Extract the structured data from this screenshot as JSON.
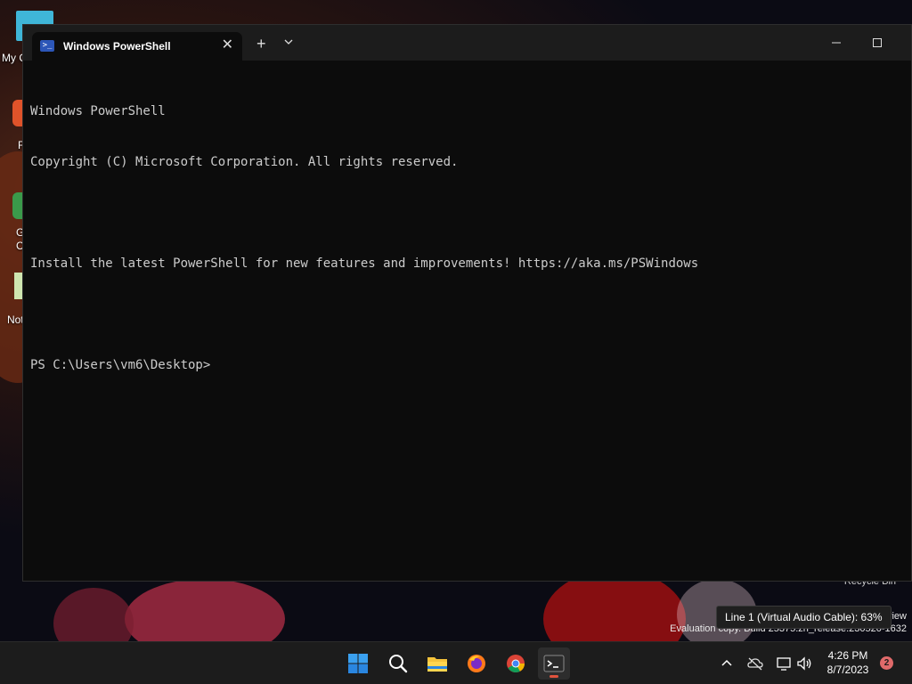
{
  "desktop": {
    "icons": [
      {
        "label": "My C",
        "top": 0
      },
      {
        "label": "F",
        "top": 0
      },
      {
        "label": "G",
        "top": 0
      },
      {
        "label": "C",
        "top": 0
      },
      {
        "label": "Not",
        "top": 0
      }
    ],
    "recycle_bin_label": "Recycle Bin",
    "watermark_preview": "view",
    "watermark_text": "Evaluation copy. Build 25375.zn_release.230520-1632",
    "tooltip_text": "Line 1 (Virtual Audio Cable): 63%"
  },
  "terminal": {
    "tab_title": "Windows PowerShell",
    "tab_icon": ">_",
    "new_tab_label": "+",
    "close_glyph": "✕",
    "console_lines": [
      "Windows PowerShell",
      "Copyright (C) Microsoft Corporation. All rights reserved.",
      "",
      "Install the latest PowerShell for new features and improvements! https://aka.ms/PSWindows",
      "",
      "PS C:\\Users\\vm6\\Desktop>"
    ]
  },
  "taskbar": {
    "apps": [
      "start-icon",
      "search-icon",
      "file-explorer-icon",
      "firefox-icon",
      "chrome-icon",
      "terminal-icon"
    ],
    "time": "4:26 PM",
    "date": "8/7/2023",
    "notification_count": "2"
  },
  "colors": {
    "accent": "#e0533d",
    "console_bg": "#0c0c0c",
    "console_text": "#cccccc",
    "taskbar_bg": "#1c1c1c"
  }
}
